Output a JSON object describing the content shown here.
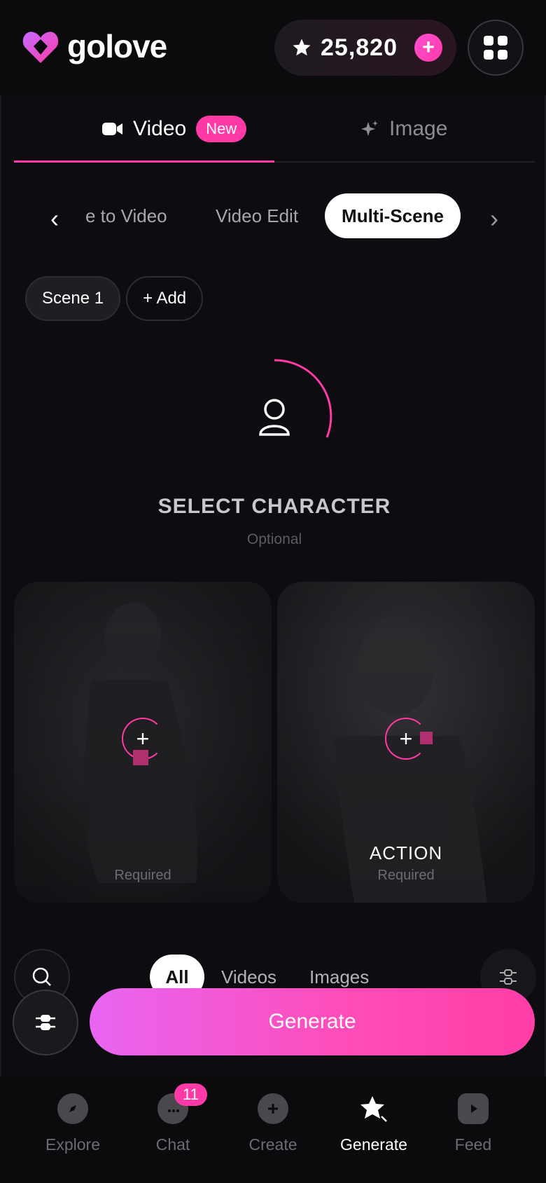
{
  "app": {
    "name": "golove"
  },
  "header": {
    "credits": "25,820",
    "add_label": "+"
  },
  "mode_tabs": {
    "video_label": "Video",
    "video_badge": "New",
    "image_label": "Image"
  },
  "sub_tabs": {
    "items": [
      "e to Video",
      "Video Edit",
      "Multi-Scene"
    ],
    "active": "Multi-Scene"
  },
  "scenes": {
    "items": [
      "Scene 1"
    ],
    "add_label": "+ Add"
  },
  "character": {
    "title": "SELECT CHARACTER",
    "subtitle": "Optional"
  },
  "cards": [
    {
      "label": "",
      "required": "Required"
    },
    {
      "label": "ACTION",
      "required": "Required"
    }
  ],
  "filters": {
    "items": [
      "All",
      "Videos",
      "Images"
    ],
    "active": "All"
  },
  "generate_label": "Generate",
  "bottom_nav": {
    "items": [
      {
        "label": "Explore",
        "icon": "compass-icon"
      },
      {
        "label": "Chat",
        "icon": "chat-icon",
        "badge": "11"
      },
      {
        "label": "Create",
        "icon": "plus-circle-icon"
      },
      {
        "label": "Generate",
        "icon": "star-sparkle-icon"
      },
      {
        "label": "Feed",
        "icon": "play-icon"
      }
    ],
    "active": "Generate"
  },
  "colors": {
    "accent": "#ff3aa6",
    "background": "#0b0a0d"
  }
}
